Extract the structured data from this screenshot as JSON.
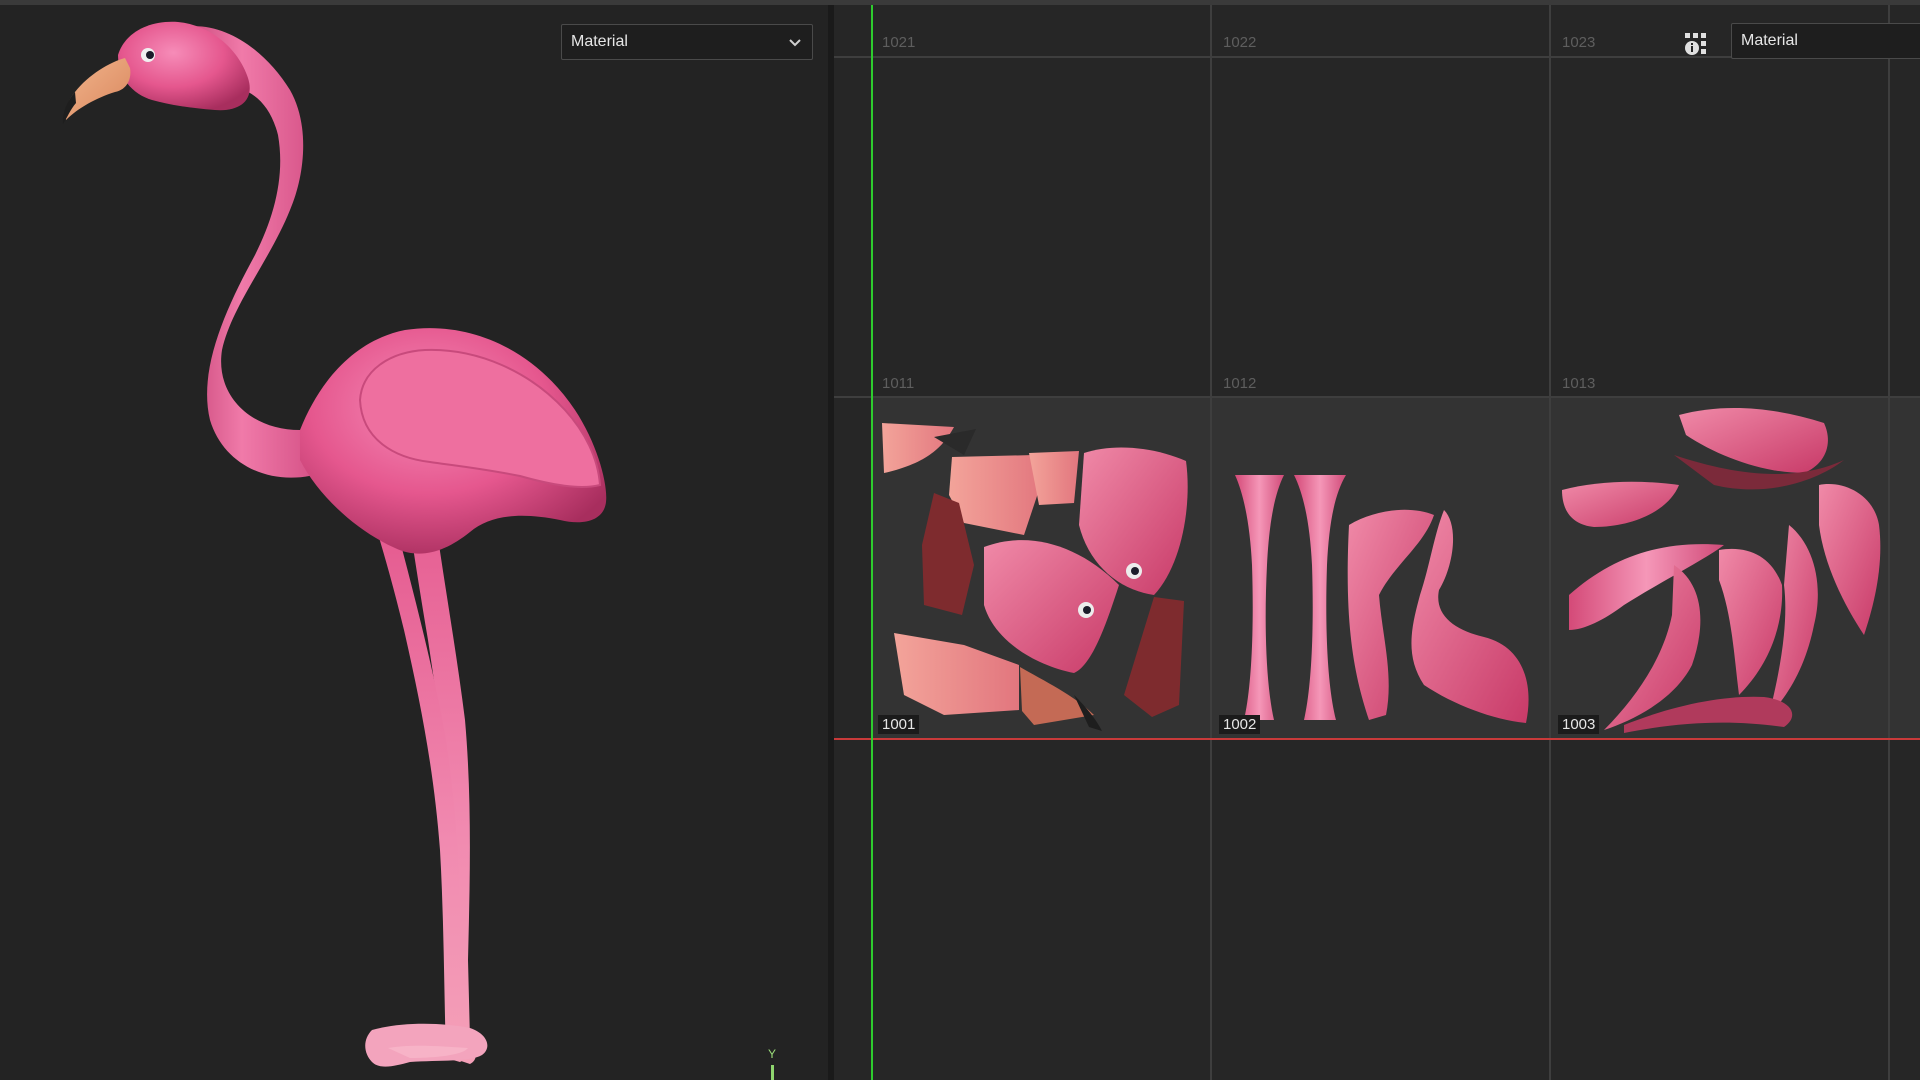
{
  "viewport_3d": {
    "shading_mode": "Material",
    "axis_label": "Y",
    "model_color": "#e8588f"
  },
  "uv_editor": {
    "shading_mode": "Material",
    "tiles": [
      {
        "id": "1021",
        "active": false
      },
      {
        "id": "1022",
        "active": false
      },
      {
        "id": "1023",
        "active": false
      },
      {
        "id": "1011",
        "active": false
      },
      {
        "id": "1012",
        "active": false
      },
      {
        "id": "1013",
        "active": false
      },
      {
        "id": "1001",
        "active": true
      },
      {
        "id": "1002",
        "active": true
      },
      {
        "id": "1003",
        "active": true
      }
    ],
    "u_axis_color": "#d03a3a",
    "v_axis_color": "#2ecc2e"
  },
  "icons": {
    "dropdown": "chevron-down-icon",
    "display_options": "grid-options-icon"
  }
}
